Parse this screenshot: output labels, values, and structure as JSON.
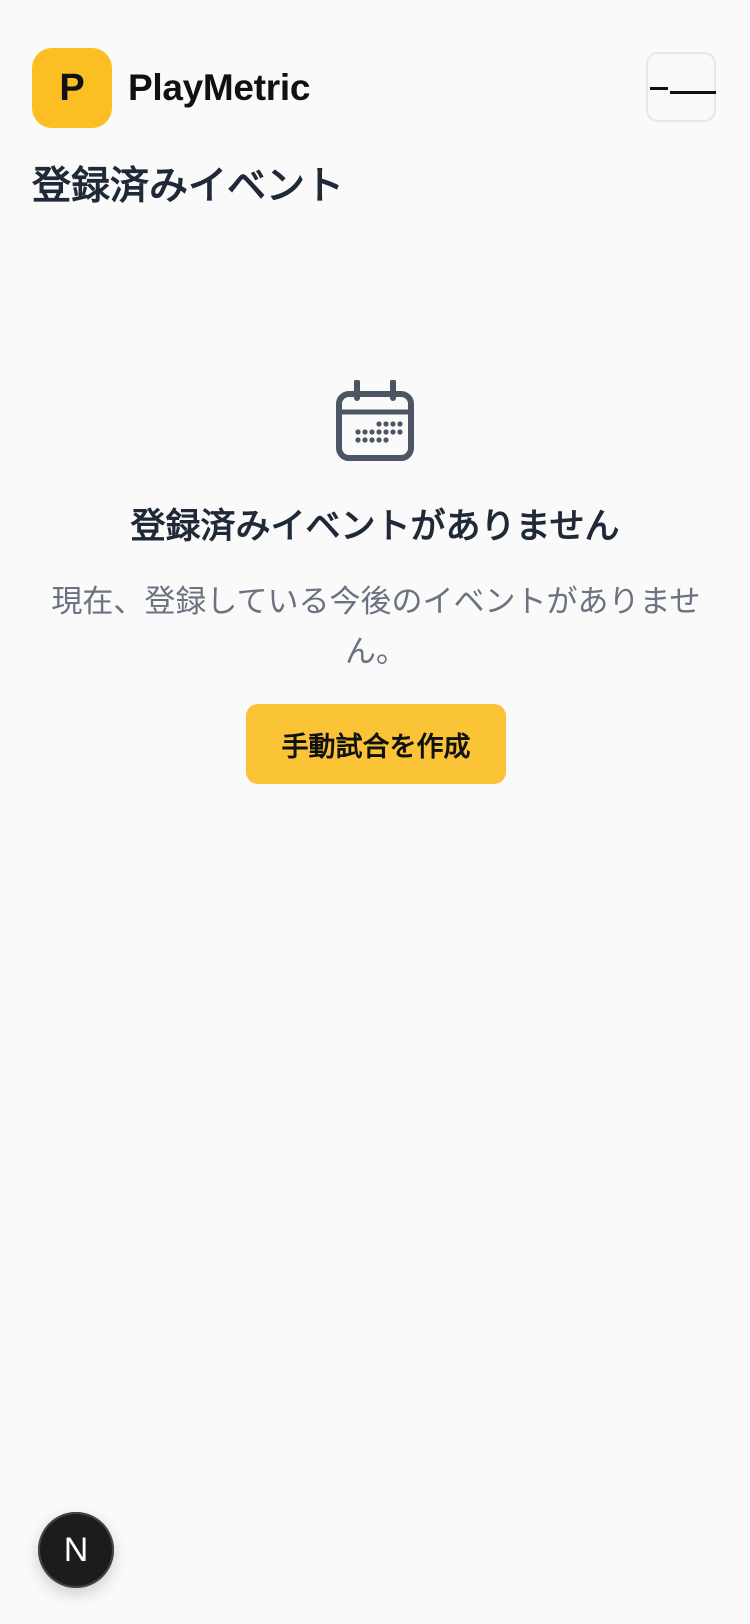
{
  "header": {
    "logo_letter": "P",
    "app_name": "PlayMetric",
    "menu_icon": "hamburger-menu-icon"
  },
  "page": {
    "title": "登録済みイベント"
  },
  "empty_state": {
    "icon": "calendar-icon",
    "title": "登録済みイベントがありません",
    "description": "現在、登録している今後のイベントがありません。",
    "button_label": "手動試合を作成"
  },
  "dev_badge": {
    "letter": "N"
  },
  "colors": {
    "accent": "#fbbf24",
    "background": "#fafafa",
    "text": "#1f2937",
    "muted": "#6b7280",
    "icon": "#4b5563"
  }
}
